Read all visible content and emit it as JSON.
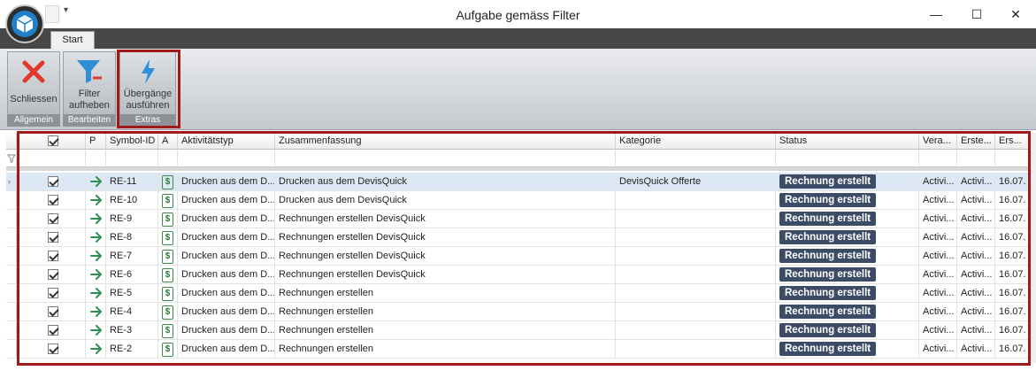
{
  "window": {
    "title": "Aufgabe gemäss Filter",
    "qat_dropdown": "▾",
    "minimize": "—",
    "maximize": "☐",
    "close": "✕"
  },
  "ribbon": {
    "tab": "Start",
    "groups": [
      {
        "label": "Allgemein",
        "button": "Schliessen"
      },
      {
        "label": "Bearbeiten",
        "button_line1": "Filter",
        "button_line2": "aufheben"
      },
      {
        "label": "Extras",
        "button_line1": "Übergänge",
        "button_line2": "ausführen"
      }
    ]
  },
  "grid": {
    "columns": [
      "P",
      "Symbol-ID",
      "A",
      "Aktivitätstyp",
      "Zusammenfassung",
      "Kategorie",
      "Status",
      "Vera...",
      "Erste...",
      "Ers..."
    ],
    "rows": [
      {
        "id": "RE-11",
        "typ": "Drucken aus dem D...",
        "summary": "Drucken aus dem DevisQuick",
        "kategorie": "DevisQuick Offerte",
        "status": "Rechnung erstellt",
        "vera": "Activi...",
        "erste": "Activi...",
        "ers": "16.07."
      },
      {
        "id": "RE-10",
        "typ": "Drucken aus dem D...",
        "summary": "Drucken aus dem DevisQuick",
        "kategorie": "",
        "status": "Rechnung erstellt",
        "vera": "Activi...",
        "erste": "Activi...",
        "ers": "16.07."
      },
      {
        "id": "RE-9",
        "typ": "Drucken aus dem D...",
        "summary": "Rechnungen erstellen DevisQuick",
        "kategorie": "",
        "status": "Rechnung erstellt",
        "vera": "Activi...",
        "erste": "Activi...",
        "ers": "16.07."
      },
      {
        "id": "RE-8",
        "typ": "Drucken aus dem D...",
        "summary": "Rechnungen erstellen DevisQuick",
        "kategorie": "",
        "status": "Rechnung erstellt",
        "vera": "Activi...",
        "erste": "Activi...",
        "ers": "16.07."
      },
      {
        "id": "RE-7",
        "typ": "Drucken aus dem D...",
        "summary": "Rechnungen erstellen DevisQuick",
        "kategorie": "",
        "status": "Rechnung erstellt",
        "vera": "Activi...",
        "erste": "Activi...",
        "ers": "16.07."
      },
      {
        "id": "RE-6",
        "typ": "Drucken aus dem D...",
        "summary": "Rechnungen erstellen DevisQuick",
        "kategorie": "",
        "status": "Rechnung erstellt",
        "vera": "Activi...",
        "erste": "Activi...",
        "ers": "16.07."
      },
      {
        "id": "RE-5",
        "typ": "Drucken aus dem D...",
        "summary": "Rechnungen erstellen",
        "kategorie": "",
        "status": "Rechnung erstellt",
        "vera": "Activi...",
        "erste": "Activi...",
        "ers": "16.07."
      },
      {
        "id": "RE-4",
        "typ": "Drucken aus dem D...",
        "summary": "Rechnungen erstellen",
        "kategorie": "",
        "status": "Rechnung erstellt",
        "vera": "Activi...",
        "erste": "Activi...",
        "ers": "16.07."
      },
      {
        "id": "RE-3",
        "typ": "Drucken aus dem D...",
        "summary": "Rechnungen erstellen",
        "kategorie": "",
        "status": "Rechnung erstellt",
        "vera": "Activi...",
        "erste": "Activi...",
        "ers": "16.07."
      },
      {
        "id": "RE-2",
        "typ": "Drucken aus dem D...",
        "summary": "Rechnungen erstellen",
        "kategorie": "",
        "status": "Rechnung erstellt",
        "vera": "Activi...",
        "erste": "Activi...",
        "ers": "16.07."
      }
    ]
  },
  "icons": {
    "close": "close-x-icon",
    "filter": "filter-remove-icon",
    "transitions": "lightning-icon",
    "row_arrow": "arrow-right-icon",
    "activity": "dollar-icon"
  },
  "colors": {
    "highlight": "#a11a1a",
    "status_badge": "#3d4c66",
    "arrow": "#2f8f4e",
    "selected_row": "#dde8f5"
  }
}
